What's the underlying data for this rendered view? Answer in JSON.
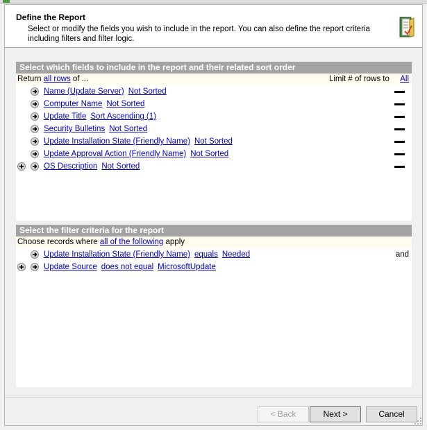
{
  "header": {
    "title": "Define the Report",
    "description": "Select or modify the fields you wish to include in the report. You can also define the report criteria including filters and filter logic."
  },
  "fields_section": {
    "title": "Select which fields to include in the report and their related sort order",
    "return_prefix": "Return",
    "return_link": "all rows",
    "return_suffix": "of ...",
    "limit_label": "Limit # of rows to",
    "limit_link": "All",
    "rows": [
      {
        "field": "Name (Update Server)",
        "sort": "Not Sorted",
        "plus": false
      },
      {
        "field": "Computer Name",
        "sort": "Not Sorted",
        "plus": false
      },
      {
        "field": "Update Title",
        "sort": "Sort Ascending (1)",
        "plus": false
      },
      {
        "field": "Security Bulletins",
        "sort": "Not Sorted",
        "plus": false
      },
      {
        "field": "Update Installation State (Friendly Name)",
        "sort": "Not Sorted",
        "plus": false
      },
      {
        "field": "Update Approval Action (Friendly Name)",
        "sort": "Not Sorted",
        "plus": false
      },
      {
        "field": "OS Description",
        "sort": "Not Sorted",
        "plus": true
      }
    ]
  },
  "filter_section": {
    "title": "Select the filter criteria for the report",
    "choose_prefix": "Choose records where",
    "choose_link": "all of the following",
    "choose_suffix": "apply",
    "rows": [
      {
        "field": "Update Installation State (Friendly Name)",
        "operator": "equals",
        "value": "Needed",
        "conjunction": "and",
        "plus": false
      },
      {
        "field": "Update Source",
        "operator": "does not equal",
        "value": "MicrosoftUpdate",
        "conjunction": "",
        "plus": true
      }
    ]
  },
  "buttons": {
    "back": "< Back",
    "next": "Next >",
    "cancel": "Cancel"
  }
}
